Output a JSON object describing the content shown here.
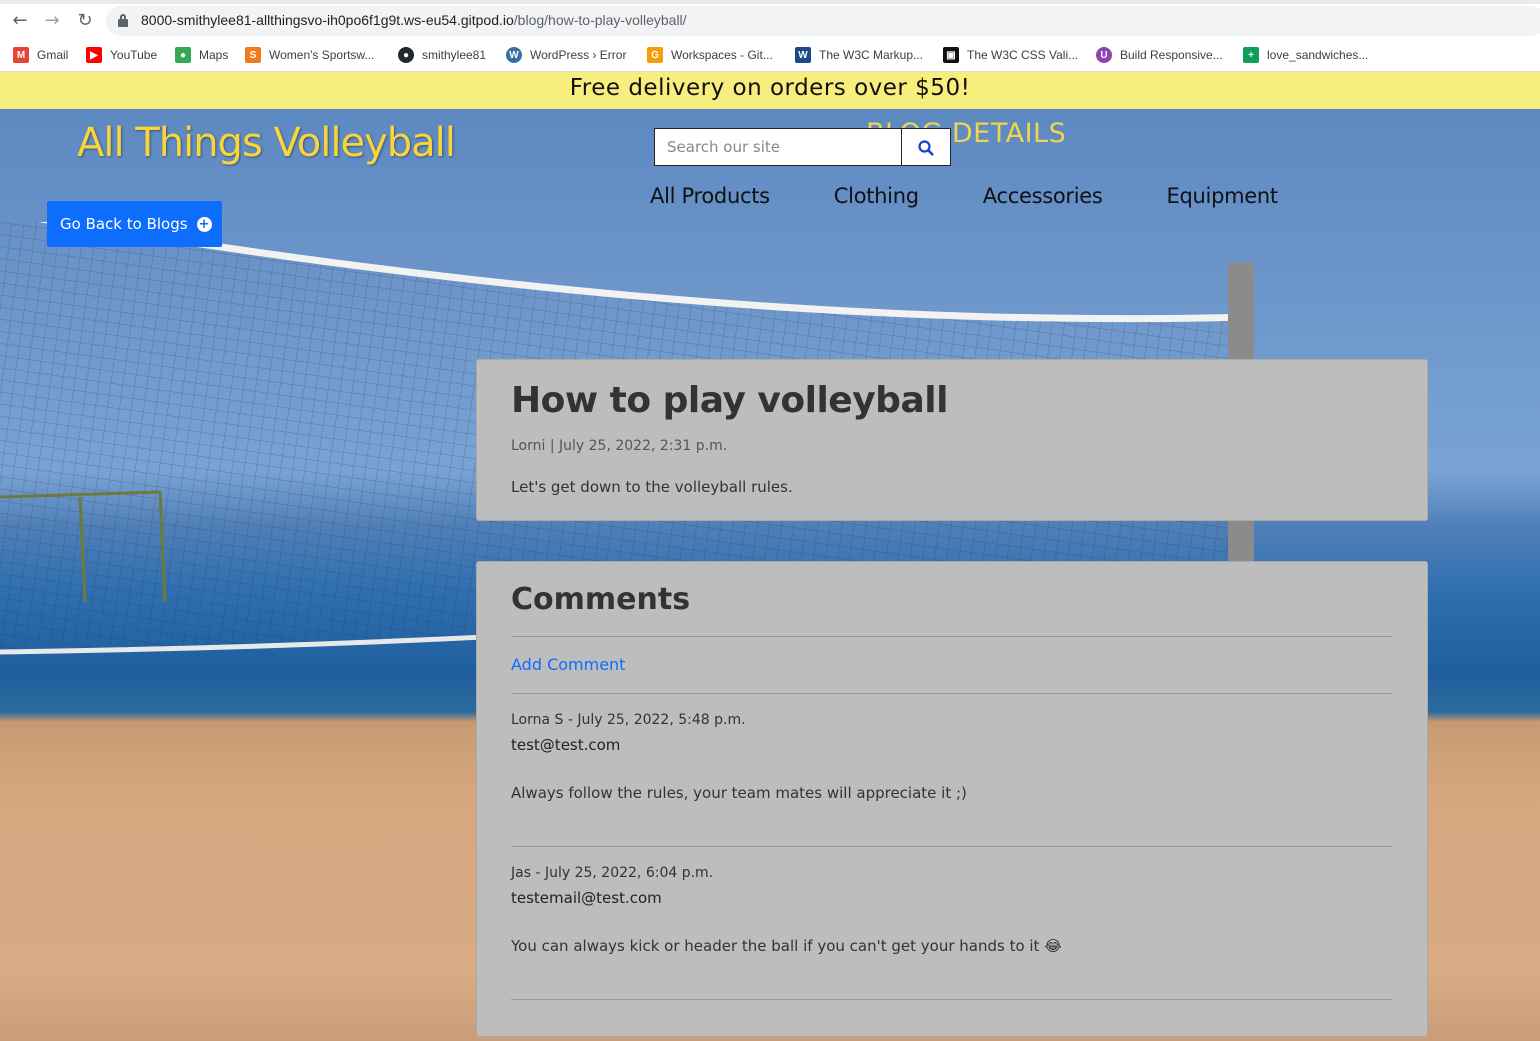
{
  "browser": {
    "url_host": "8000-smithylee81-allthingsvo-ih0po6f1g9t.ws-eu54.gitpod.io",
    "url_path": "/blog/how-to-play-volleyball/",
    "bookmarks": [
      {
        "label": "Gmail",
        "icon": "gmail-icon",
        "color": "#ea4335"
      },
      {
        "label": "YouTube",
        "icon": "youtube-icon",
        "color": "#ff0000"
      },
      {
        "label": "Maps",
        "icon": "maps-icon",
        "color": "#34a853"
      },
      {
        "label": "Women's Sportsw...",
        "icon": "sportswear-icon",
        "color": "#f07c22"
      },
      {
        "label": "smithylee81",
        "icon": "github-icon",
        "color": "#24292f"
      },
      {
        "label": "WordPress › Error",
        "icon": "wordpress-icon",
        "color": "#3a6ea5"
      },
      {
        "label": "Workspaces - Git...",
        "icon": "gitpod-icon",
        "color": "#f59e0b"
      },
      {
        "label": "The W3C Markup...",
        "icon": "w3c-icon",
        "color": "#1a4a8a"
      },
      {
        "label": "The W3C CSS Vali...",
        "icon": "w3c-css-icon",
        "color": "#111111"
      },
      {
        "label": "Build Responsive...",
        "icon": "udemy-icon",
        "color": "#8e44ad"
      },
      {
        "label": "love_sandwiches...",
        "icon": "sheets-icon",
        "color": "#0f9d58"
      }
    ]
  },
  "site": {
    "promo": "Free delivery on orders over $50!",
    "logo": "All Things Volleyball",
    "page_heading": "BLOG DETAILS",
    "search_placeholder": "Search our site",
    "nav": [
      "All Products",
      "Clothing",
      "Accessories",
      "Equipment"
    ],
    "back_button": "Go Back to Blogs"
  },
  "post": {
    "title": "How to play volleyball",
    "meta": "Lorni | July 25, 2022, 2:31 p.m.",
    "excerpt": "Let's get down to the volleyball rules."
  },
  "comments": {
    "title": "Comments",
    "add_label": "Add Comment",
    "items": [
      {
        "author": "Lorna S - July 25, 2022, 5:48 p.m.",
        "email": "test@test.com",
        "body": "Always follow the rules, your team mates will appreciate it ;)"
      },
      {
        "author": "Jas - July 25, 2022, 6:04 p.m.",
        "email": "testemail@test.com",
        "body": "You can always kick or header the ball if you can't get your hands to it 😂"
      }
    ]
  }
}
